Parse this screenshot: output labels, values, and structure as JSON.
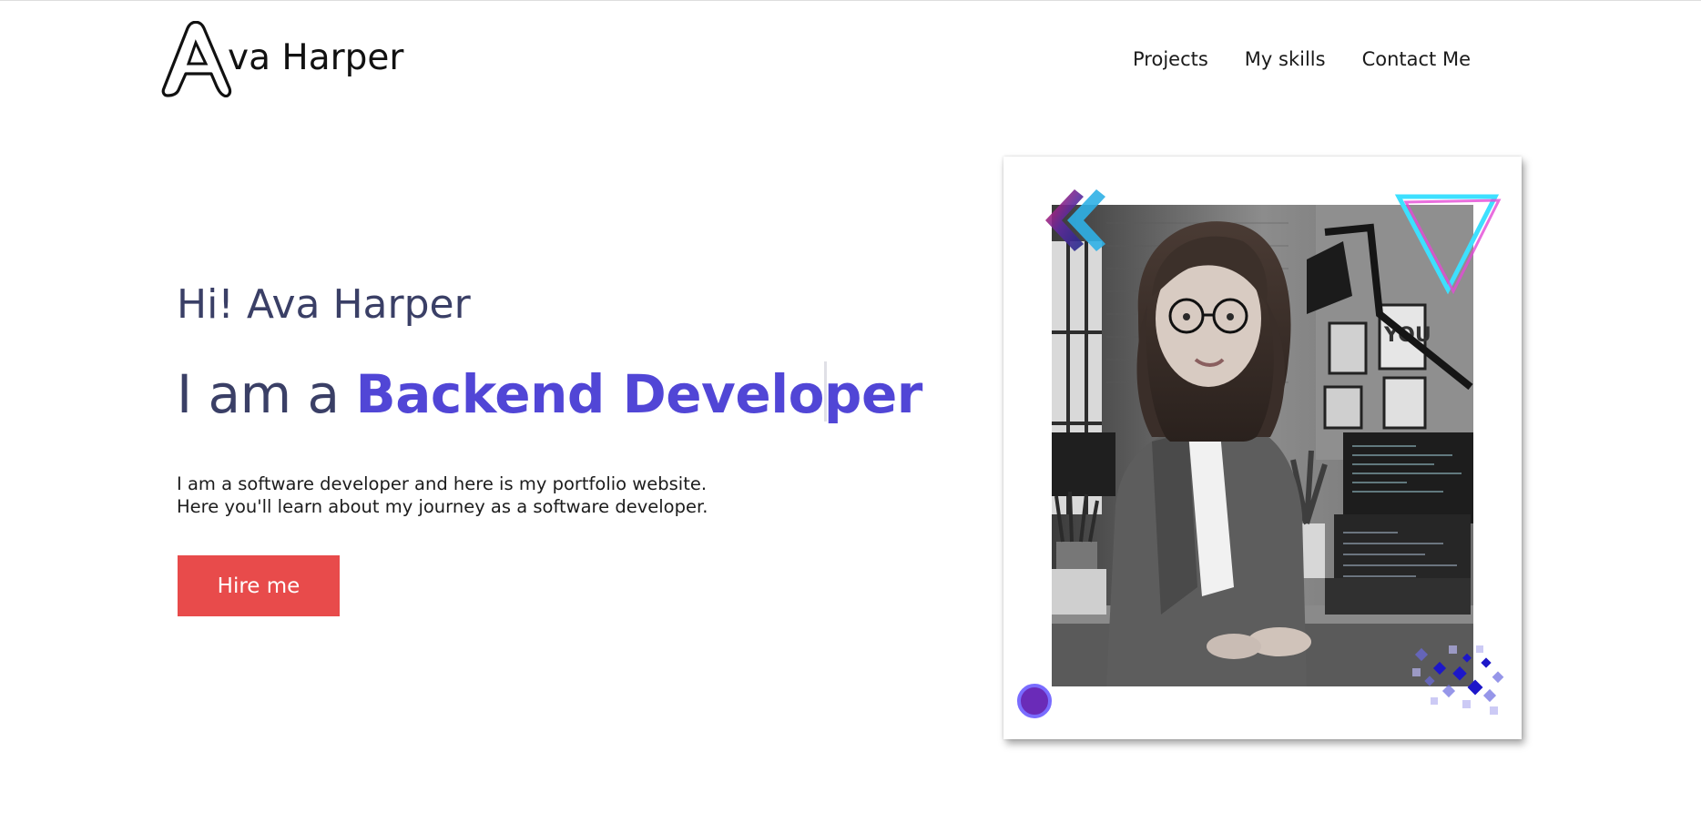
{
  "header": {
    "logo_letter": "A",
    "logo_rest": "va Harper",
    "nav": [
      {
        "label": "Projects"
      },
      {
        "label": "My skills"
      },
      {
        "label": "Contact Me"
      }
    ]
  },
  "hero": {
    "greeting": "Hi! Ava Harper",
    "headline_prefix": "I am a ",
    "headline_role": "Backend Developer",
    "description_lines": [
      "I am a software developer and here is my portfolio website.",
      "Here you'll learn about my journey as a software developer."
    ],
    "cta_label": "Hire me"
  },
  "portrait": {
    "sign_text": "YOU"
  },
  "colors": {
    "accent": "#5146d6",
    "text_muted": "#3a3f66",
    "cta": "#e84b4b"
  }
}
